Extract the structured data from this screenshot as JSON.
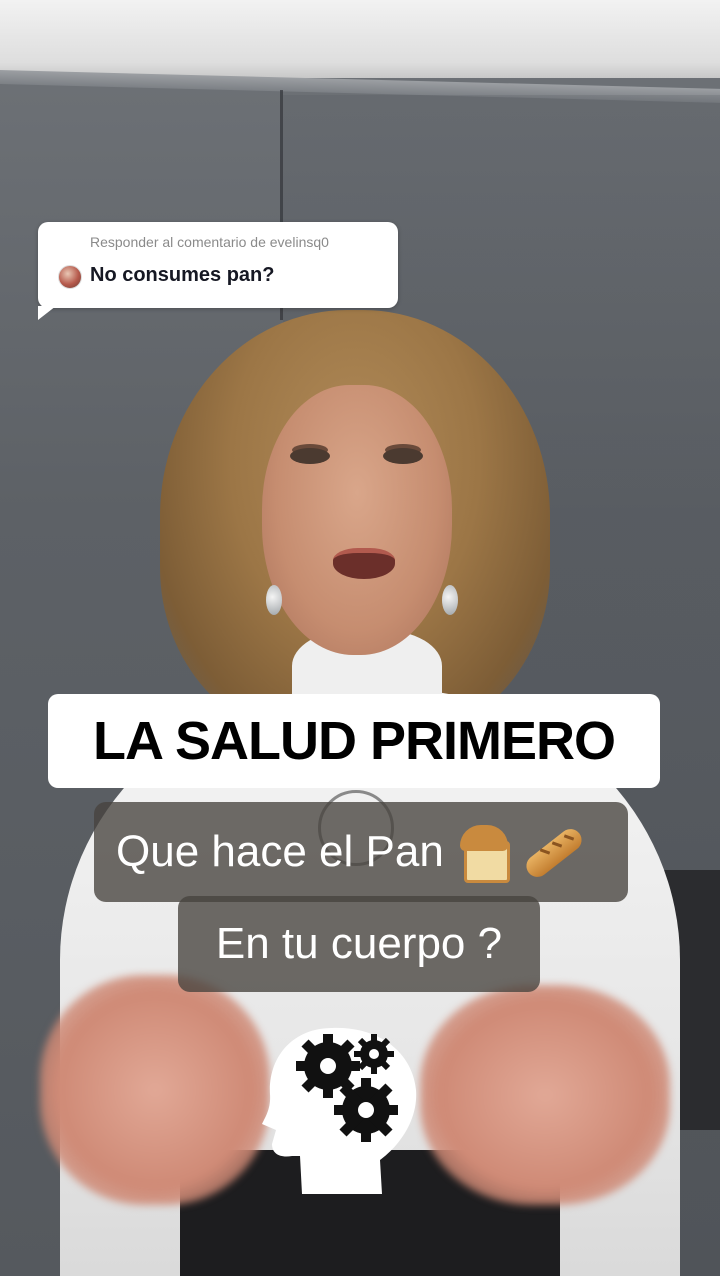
{
  "reply": {
    "label": "Responder al comentario de evelinsq0",
    "text": "No consumes pan?"
  },
  "headline": "LA SALUD PRIMERO",
  "caption": {
    "line1": "Que hace el Pan",
    "line2": "En tu cuerpo ?",
    "icons": [
      "bread-icon",
      "baguette-icon"
    ]
  },
  "overlay_icon": "head-gears-icon",
  "colors": {
    "headline_bg": "#ffffff",
    "headline_text": "#000000",
    "caption_bg": "#46423e",
    "caption_text": "#ffffff",
    "reply_bg": "#ffffff"
  }
}
